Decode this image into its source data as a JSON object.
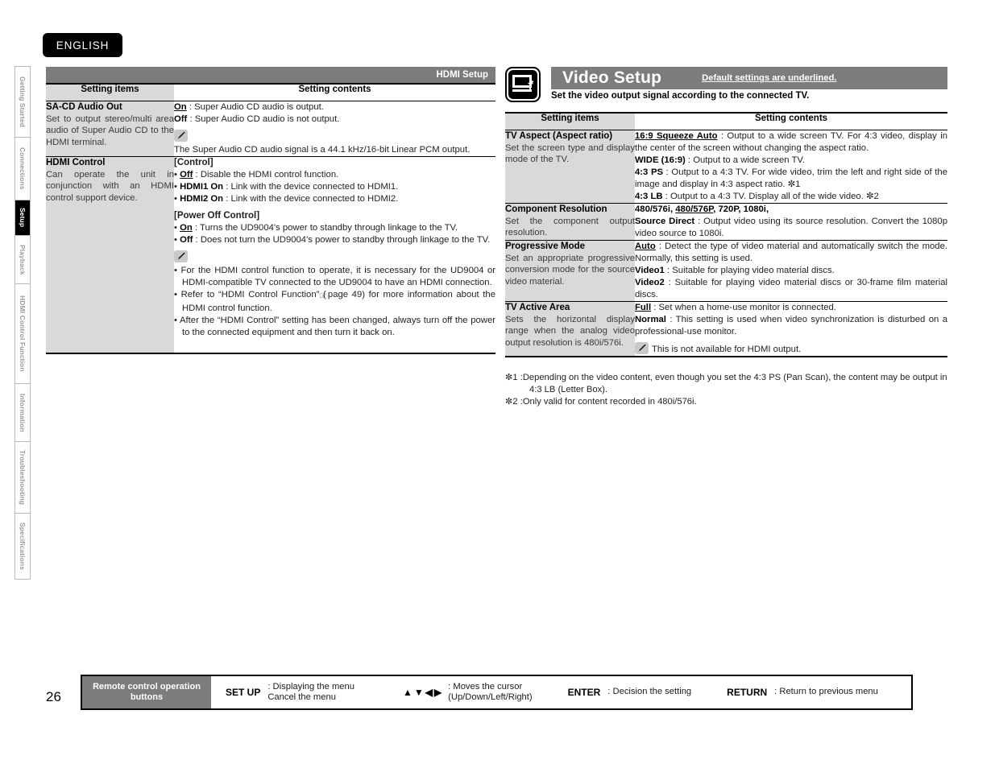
{
  "language_badge": "ENGLISH",
  "page_number": "26",
  "sidebar": {
    "items": [
      {
        "label": "Getting Started",
        "active": false
      },
      {
        "label": "Connections",
        "active": false
      },
      {
        "label": "Setup",
        "active": true
      },
      {
        "label": "Playback",
        "active": false
      },
      {
        "label": "HDMI Control Function",
        "active": false
      },
      {
        "label": "Information",
        "active": false
      },
      {
        "label": "Troubleshooting",
        "active": false
      },
      {
        "label": "Specifications",
        "active": false
      }
    ]
  },
  "left_section": {
    "banner": "HDMI Setup",
    "columns": {
      "items": "Setting items",
      "contents": "Setting contents"
    },
    "rows": [
      {
        "title": "SA-CD Audio Out",
        "desc": "Set to output stereo/multi area audio of  Super Audio CD to the HDMI  terminal.",
        "opt_on_label": "On",
        "opt_on_text": ": Super Audio CD audio is output.",
        "opt_off_label": "Off",
        "opt_off_text": ": Super Audio CD audio is not output.",
        "note": "The Super Audio CD audio signal is a 44.1 kHz/16-bit Linear PCM output."
      },
      {
        "title": "HDMI Control",
        "desc": "Can operate the unit in conjunction with an HDMI control support device.",
        "sect1": "[Control]",
        "c1_label": "Off",
        "c1_text": ": Disable the HDMI control function.",
        "c2_label": "HDMI1 On",
        "c2_text": ": Link with the device connected to HDMI1.",
        "c3_label": "HDMI2 On",
        "c3_text": ": Link with the device connected to HDMI2.",
        "sect2": "[Power Off Control]",
        "p1_label": "On",
        "p1_text": ": Turns the UD9004's power to standby through linkage to the TV.",
        "p2_label": "Off",
        "p2_text": ": Does not turn the UD9004's power to standby through linkage to the TV.",
        "note1": "For the HDMI control function to operate, it is necessary for the UD9004 or HDMI-compatible TV connected to the UD9004  to have an HDMI connection.",
        "note2a": "Refer to “HDMI Control Function” (",
        "note2b": "page 49) for more information about the HDMI control function.",
        "note3": "After the “HDMI Control” setting has been changed, always turn off the power to the connected equipment and then turn it back on."
      }
    ]
  },
  "right_section": {
    "title": "Video Setup",
    "default_note": "Default settings are underlined.",
    "subtitle": "Set the video output signal according to the connected TV.",
    "columns": {
      "items": "Setting items",
      "contents": "Setting contents"
    },
    "rows": [
      {
        "title": "TV Aspect (Aspect ratio)",
        "desc": "Set the screen type and display mode of the TV.",
        "options": [
          {
            "label": "16:9 Squeeze Auto",
            "underline": true,
            "text": ": Output to a wide screen TV. For 4:3 video, display in the center of the screen without changing the aspect ratio."
          },
          {
            "label": "WIDE (16:9)",
            "underline": false,
            "text": ": Output to a wide screen TV."
          },
          {
            "label": "4:3 PS",
            "underline": false,
            "text": ": Output to a 4:3 TV. For wide video, trim the left and right side of the image and display in 4:3 aspect ratio.  ✼1"
          },
          {
            "label": "4:3 LB",
            "underline": false,
            "text": ": Output to a 4:3 TV. Display all of the wide video.  ✼2"
          }
        ]
      },
      {
        "title": "Component Resolution",
        "desc": "Set the component output resolution.",
        "res_line_a": "480/576i, ",
        "res_line_b": "480/576P",
        "res_line_c": ", 720P, 1080i,",
        "options": [
          {
            "label": "Source Direct",
            "underline": false,
            "text": ": Output video using its source resolution. Convert the 1080p video source to 1080i."
          }
        ]
      },
      {
        "title": "Progressive Mode",
        "desc": "Set an appropriate progressive conversion mode for the source video material.",
        "options": [
          {
            "label": "Auto",
            "underline": true,
            "text": ": Detect the type of video material and automatically switch the mode. Normally, this setting is used."
          },
          {
            "label": "Video1",
            "underline": false,
            "text": ": Suitable for playing video material discs."
          },
          {
            "label": "Video2",
            "underline": false,
            "text": ": Suitable for playing video material discs or 30-frame film material discs."
          }
        ]
      },
      {
        "title": "TV Active Area",
        "desc": "Sets the horizontal display range when the analog video output resolution is 480i/576i.",
        "options": [
          {
            "label": "Full",
            "underline": true,
            "text": ": Set when a home-use monitor is connected."
          },
          {
            "label": "Normal",
            "underline": false,
            "text": ": This setting is used when video synchronization is disturbed on a professional-use monitor."
          }
        ],
        "note": "This is not available for HDMI output."
      }
    ],
    "footnotes": [
      {
        "marker": "✼1 :",
        "text": "Depending on the video content, even though you set the 4:3 PS (Pan Scan), the content may be output in 4:3 LB (Letter Box)."
      },
      {
        "marker": "✼2 :",
        "text": "Only valid for content recorded in 480i/576i."
      }
    ]
  },
  "remote_bar": {
    "label": "Remote control operation buttons",
    "entries": [
      {
        "key": "SET UP",
        "desc_line1": ": Displaying the menu",
        "desc_line2": "Cancel the menu"
      },
      {
        "key": "▲▼◀▶",
        "desc_line1": ": Moves the cursor",
        "desc_line2": "(Up/Down/Left/Right)"
      },
      {
        "key": "ENTER",
        "desc_line1": ": Decision the setting",
        "desc_line2": ""
      },
      {
        "key": "RETURN",
        "desc_line1": ": Return to previous menu",
        "desc_line2": ""
      }
    ]
  },
  "colors": {
    "grey_banner": "#7c7c7c",
    "header_cell": "#d9d9d9",
    "item_cell": "#d9d9d9",
    "active_tab": "#000000"
  }
}
